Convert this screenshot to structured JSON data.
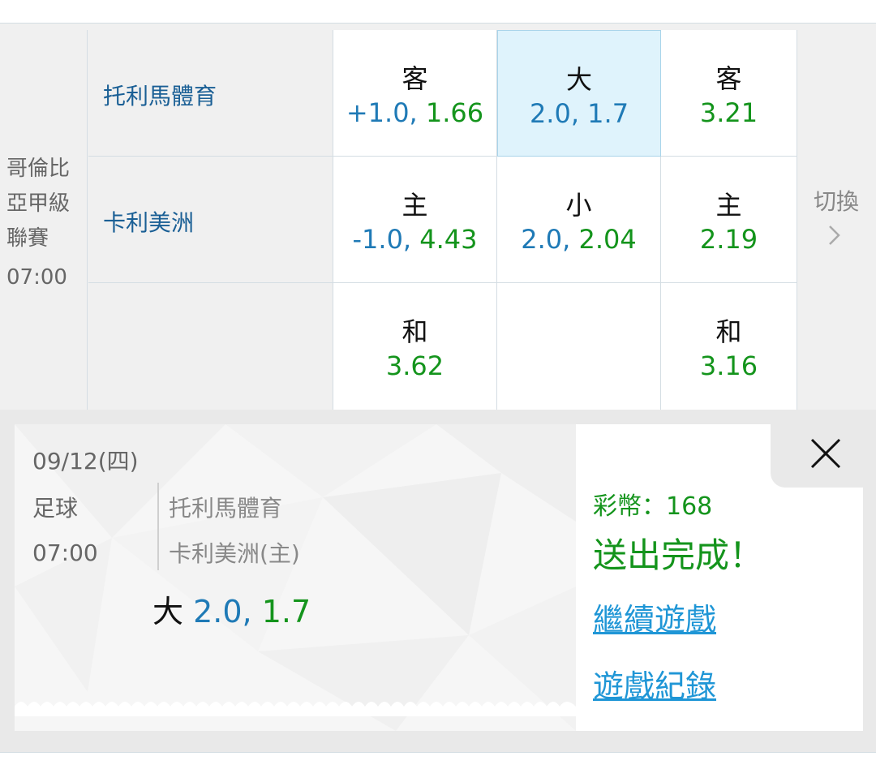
{
  "league": {
    "name": "哥倫比亞甲級聯賽",
    "time": "07:00"
  },
  "teams": {
    "away": "托利馬體育",
    "home": "卡利美洲"
  },
  "odds": {
    "handicap": [
      {
        "label": "客",
        "value": "+1.0, 1.66"
      },
      {
        "label": "主",
        "value": "-1.0, 4.43"
      },
      {
        "label": "和",
        "value": "3.62"
      }
    ],
    "total": [
      {
        "label": "大",
        "line": "2.0,",
        "price": "1.7",
        "selected": true
      },
      {
        "label": "小",
        "line": "2.0,",
        "price": "2.04"
      }
    ],
    "moneyline": [
      {
        "label": "客",
        "value": "3.21"
      },
      {
        "label": "主",
        "value": "2.19"
      },
      {
        "label": "和",
        "value": "3.16"
      }
    ]
  },
  "switch": {
    "label": "切換"
  },
  "ticket": {
    "date": "09/12(四)",
    "sport": "足球",
    "time": "07:00",
    "team1": "托利馬體育",
    "team2": "卡利美洲(主)",
    "bet_type": "大",
    "bet_line": "2.0,",
    "bet_price": "1.7",
    "coins": "彩幣：168",
    "status": "送出完成！",
    "continue_link": "繼續遊戲",
    "history_link": "遊戲紀錄"
  },
  "colors": {
    "blue": "#1f7ab6",
    "green": "#14941c",
    "link": "#1f96d6",
    "selected_bg": "#dff3fc"
  }
}
